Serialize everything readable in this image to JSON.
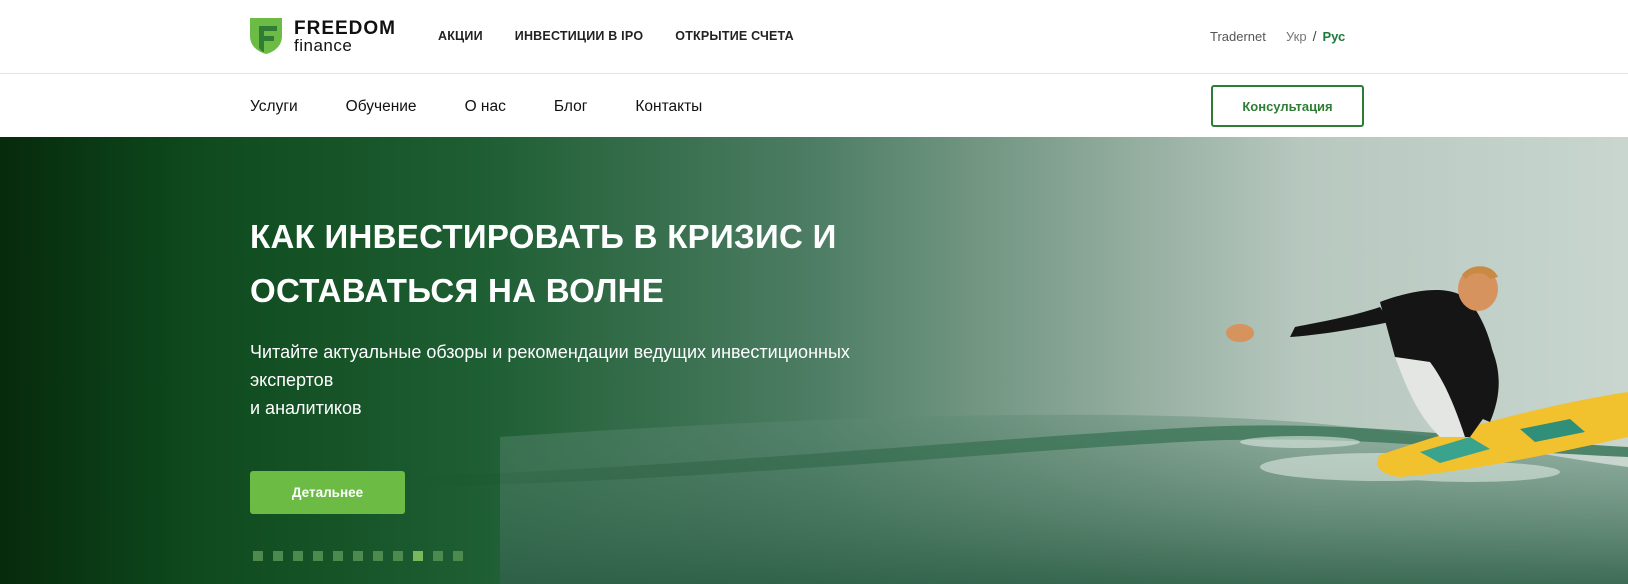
{
  "brand": {
    "name_line1": "FREEDOM",
    "name_line2": "finance",
    "color_primary": "#6cbb45",
    "color_dark": "#2f7d35"
  },
  "header_top": {
    "nav": [
      {
        "label": "АКЦИИ"
      },
      {
        "label": "ИНВЕСТИЦИИ В IPO"
      },
      {
        "label": "ОТКРЫТИЕ СЧЕТА"
      }
    ],
    "tradernet": "Tradernet",
    "lang": {
      "ukr": "Укр",
      "separator": "/",
      "rus": "Рус",
      "active": "Рус"
    }
  },
  "header_bottom": {
    "nav": [
      {
        "label": "Услуги"
      },
      {
        "label": "Обучение"
      },
      {
        "label": "О нас"
      },
      {
        "label": "Блог"
      },
      {
        "label": "Контакты"
      }
    ],
    "consult_label": "Консультация"
  },
  "hero": {
    "title_line1": "КАК ИНВЕСТИРОВАТЬ В КРИЗИС И",
    "title_line2": "ОСТАВАТЬСЯ НА ВОЛНЕ",
    "subtitle_line1": "Читайте актуальные обзоры и рекомендации ведущих инвестиционных экспертов",
    "subtitle_line2": "и аналитиков",
    "cta_label": "Детальнее",
    "slides_count": 11,
    "active_slide": 9
  }
}
